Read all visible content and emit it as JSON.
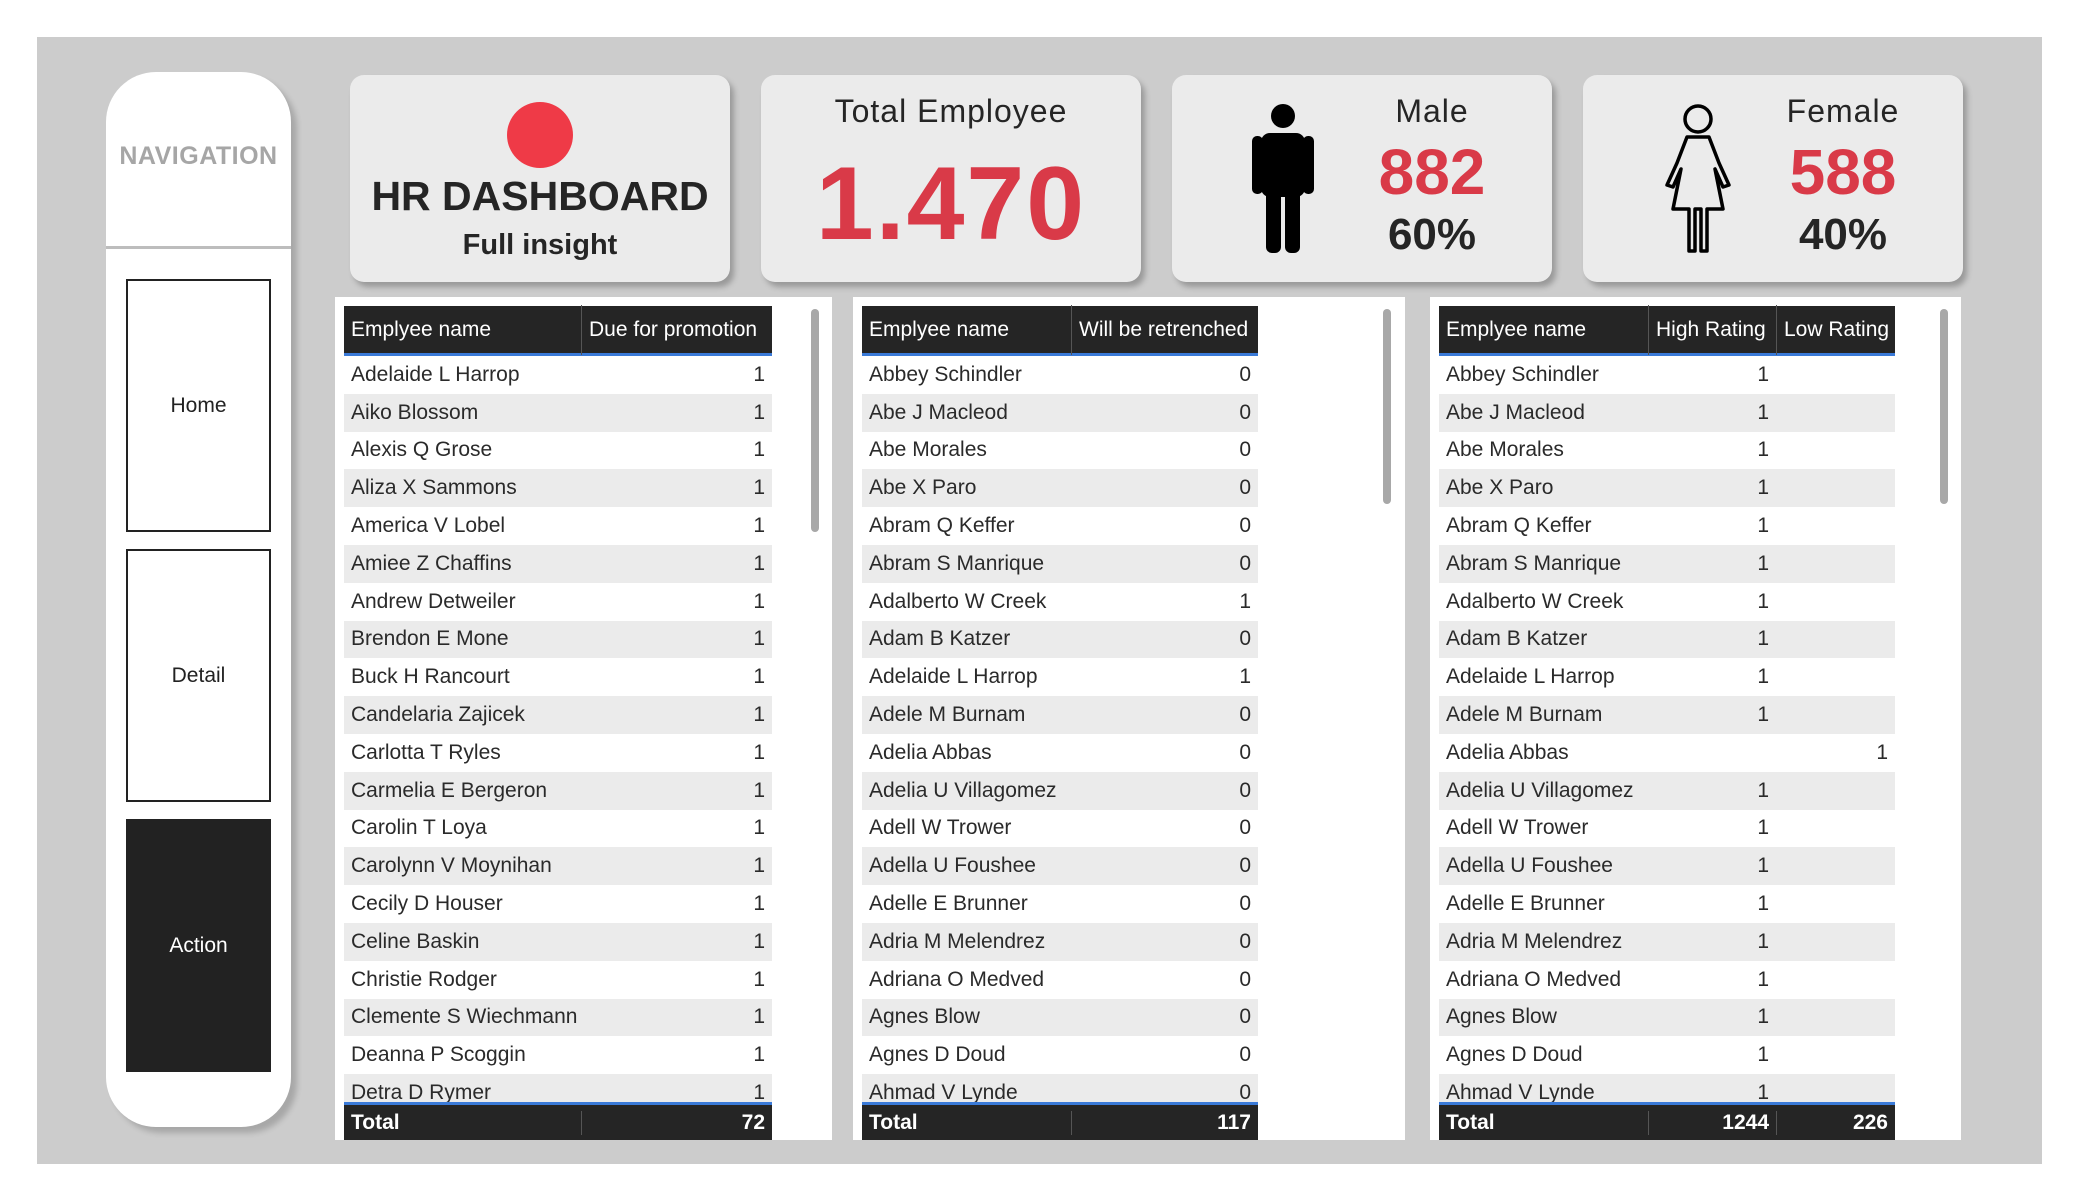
{
  "nav": {
    "title": "NAVIGATION",
    "items": [
      "Home",
      "Detail",
      "Action"
    ],
    "active": "Action"
  },
  "kpi": {
    "brand_title": "HR DASHBOARD",
    "brand_subtitle": "Full insight",
    "total_label": "Total Employee",
    "total_value": "1.470",
    "male_label": "Male",
    "male_value": "882",
    "male_pct": "60%",
    "female_label": "Female",
    "female_value": "588",
    "female_pct": "40%"
  },
  "colors": {
    "accent_red": "#d93a48",
    "header_dark": "#252525",
    "canvas": "#cccccc"
  },
  "promotion_table": {
    "headers": [
      "Emplyee name",
      "Due for promotion"
    ],
    "rows": [
      [
        "Adelaide L Harrop",
        "1"
      ],
      [
        "Aiko Blossom",
        "1"
      ],
      [
        "Alexis Q Grose",
        "1"
      ],
      [
        "Aliza X Sammons",
        "1"
      ],
      [
        "America V Lobel",
        "1"
      ],
      [
        "Amiee Z Chaffins",
        "1"
      ],
      [
        "Andrew Detweiler",
        "1"
      ],
      [
        "Brendon E Mone",
        "1"
      ],
      [
        "Buck H Rancourt",
        "1"
      ],
      [
        "Candelaria Zajicek",
        "1"
      ],
      [
        "Carlotta T Ryles",
        "1"
      ],
      [
        "Carmelia E Bergeron",
        "1"
      ],
      [
        "Carolin T Loya",
        "1"
      ],
      [
        "Carolynn V Moynihan",
        "1"
      ],
      [
        "Cecily D Houser",
        "1"
      ],
      [
        "Celine Baskin",
        "1"
      ],
      [
        "Christie Rodger",
        "1"
      ],
      [
        "Clemente S Wiechmann",
        "1"
      ],
      [
        "Deanna P Scoggin",
        "1"
      ],
      [
        "Detra D Rymer",
        "1"
      ]
    ],
    "total": [
      "Total",
      "72"
    ]
  },
  "retrench_table": {
    "headers": [
      "Emplyee name",
      "Will be retrenched"
    ],
    "rows": [
      [
        "Abbey Schindler",
        "0"
      ],
      [
        "Abe J Macleod",
        "0"
      ],
      [
        "Abe Morales",
        "0"
      ],
      [
        "Abe X Paro",
        "0"
      ],
      [
        "Abram Q Keffer",
        "0"
      ],
      [
        "Abram S Manrique",
        "0"
      ],
      [
        "Adalberto W Creek",
        "1"
      ],
      [
        "Adam B Katzer",
        "0"
      ],
      [
        "Adelaide L Harrop",
        "1"
      ],
      [
        "Adele M Burnam",
        "0"
      ],
      [
        "Adelia Abbas",
        "0"
      ],
      [
        "Adelia U Villagomez",
        "0"
      ],
      [
        "Adell W Trower",
        "0"
      ],
      [
        "Adella U Foushee",
        "0"
      ],
      [
        "Adelle E Brunner",
        "0"
      ],
      [
        "Adria M Melendrez",
        "0"
      ],
      [
        "Adriana O Medved",
        "0"
      ],
      [
        "Agnes Blow",
        "0"
      ],
      [
        "Agnes D Doud",
        "0"
      ],
      [
        "Ahmad V Lynde",
        "0"
      ]
    ],
    "total": [
      "Total",
      "117"
    ]
  },
  "rating_table": {
    "headers": [
      "Emplyee name",
      "High Rating",
      "Low Rating"
    ],
    "rows": [
      [
        "Abbey Schindler",
        "1",
        ""
      ],
      [
        "Abe J Macleod",
        "1",
        ""
      ],
      [
        "Abe Morales",
        "1",
        ""
      ],
      [
        "Abe X Paro",
        "1",
        ""
      ],
      [
        "Abram Q Keffer",
        "1",
        ""
      ],
      [
        "Abram S Manrique",
        "1",
        ""
      ],
      [
        "Adalberto W Creek",
        "1",
        ""
      ],
      [
        "Adam B Katzer",
        "1",
        ""
      ],
      [
        "Adelaide L Harrop",
        "1",
        ""
      ],
      [
        "Adele M Burnam",
        "1",
        ""
      ],
      [
        "Adelia Abbas",
        "",
        "1"
      ],
      [
        "Adelia U Villagomez",
        "1",
        ""
      ],
      [
        "Adell W Trower",
        "1",
        ""
      ],
      [
        "Adella U Foushee",
        "1",
        ""
      ],
      [
        "Adelle E Brunner",
        "1",
        ""
      ],
      [
        "Adria M Melendrez",
        "1",
        ""
      ],
      [
        "Adriana O Medved",
        "1",
        ""
      ],
      [
        "Agnes Blow",
        "1",
        ""
      ],
      [
        "Agnes D Doud",
        "1",
        ""
      ],
      [
        "Ahmad V Lynde",
        "1",
        ""
      ]
    ],
    "total": [
      "Total",
      "1244",
      "226"
    ]
  }
}
